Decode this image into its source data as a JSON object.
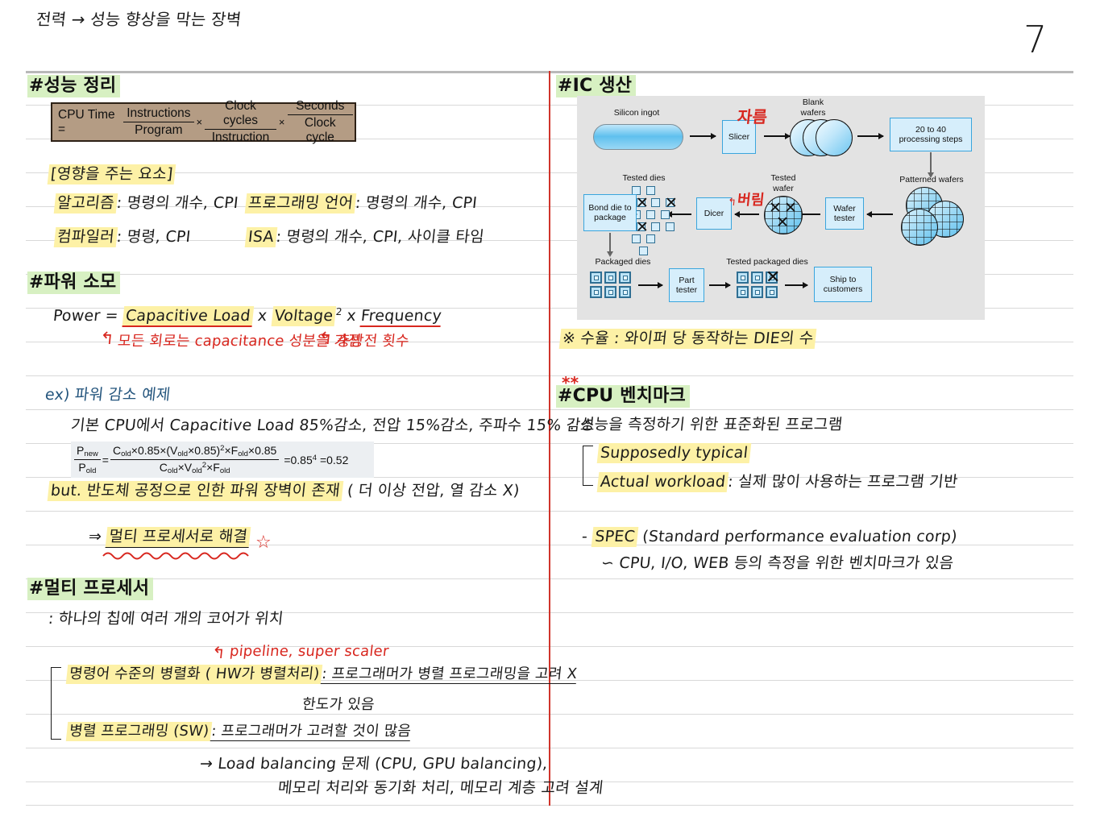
{
  "page": {
    "header_title": "전력 → 성능 향상을 막는 장벽",
    "page_number": "7"
  },
  "left_column": {
    "section1": {
      "heading": "#성능 정리",
      "formula": {
        "lhs": "CPU Time =",
        "f1_num": "Instructions",
        "f1_den": "Program",
        "op1": "×",
        "f2_num": "Clock cycles",
        "f2_den": "Instruction",
        "op2": "×",
        "f3_num": "Seconds",
        "f3_den": "Clock cycle"
      },
      "subtitle": "[영향을 주는 요소]",
      "factors": [
        {
          "term": "알고리즘",
          "desc": ": 명령의 개수, CPI"
        },
        {
          "term": "프로그래밍 언어",
          "desc": ": 명령의 개수, CPI"
        },
        {
          "term": "컴파일러",
          "desc": ": 명령, CPI"
        },
        {
          "term": "ISA",
          "desc": ": 명령의 개수, CPI, 사이클 타임"
        }
      ]
    },
    "section2": {
      "heading": "#파워 소모",
      "formula_lead": "Power =",
      "formula_t1": "Capacitive Load",
      "formula_op1": "x",
      "formula_t2": "Voltage",
      "formula_t2_sup": "2",
      "formula_op2": "x",
      "formula_t3": "Frequency",
      "note1": "모든 회로는 capacitance 성분을 가짐",
      "note2": "충방전 횟수",
      "example_label": "ex) 파워 감소 예제",
      "example_text": "기본 CPU에서  Capacitive Load 85%감소, 전압 15%감소, 주파수 15% 감소",
      "ratio": {
        "lhs_num": "P",
        "lhs_num_sub": "new",
        "lhs_den": "P",
        "lhs_den_sub": "old",
        "eq1": "=",
        "num": "C_old × 0.85 × (V_old × 0.85)² × F_old × 0.85",
        "den": "C_old × V_old² × F_old",
        "result": "= 0.85⁴ = 0.52"
      },
      "but_line_hl": "but. 반도체 공정으로 인한 파워 장벽이 존재",
      "but_line_rest": "( 더 이상 전압, 열 감소 X)",
      "solution_arrow": "⇒",
      "solution": "멀티 프로세서로 해결"
    },
    "section3": {
      "heading": "#멀티 프로세서",
      "line1": ": 하나의 칩에 여러 개의  코어가 위치",
      "red_note": "pipeline, super scaler",
      "item1_hl": "명령어 수준의 병렬화 ( HW가 병렬처리)",
      "item1_desc": ": 프로그래머가  병렬  프로그래밍을  고려 X",
      "item1_desc2": "한도가 있음",
      "item2_hl": "병렬 프로그래밍 (SW)",
      "item2_desc": ": 프로그래머가  고려할  것이  많음",
      "tail1": "→ Load balancing 문제 (CPU, GPU balancing),",
      "tail2": "메모리 처리와 동기화 처리, 메모리 계층 고려 설계"
    }
  },
  "right_column": {
    "section1": {
      "heading": "#IC 생산",
      "diagram": {
        "labels": {
          "silicon_ingot": "Silicon ingot",
          "blank_wafers_1": "Blank",
          "blank_wafers_2": "wafers",
          "patterned_wafers": "Patterned wafers",
          "tested_dies": "Tested dies",
          "tested_wafer_1": "Tested",
          "tested_wafer_2": "wafer",
          "packaged_dies": "Packaged dies",
          "tested_packaged_dies": "Tested packaged dies"
        },
        "boxes": {
          "slicer": "Slicer",
          "processing_steps": "20 to 40\nprocessing steps",
          "wafer_tester": "Wafer\ntester",
          "dicer": "Dicer",
          "bond_die": "Bond die to\npackage",
          "part_tester": "Part\ntester",
          "ship": "Ship to\ncustomers"
        },
        "annotations": {
          "cut": "자름",
          "discard": "버림"
        }
      },
      "yield_note": "※ 수율 : 와이퍼 당 동작하는 DIE의 수"
    },
    "section2": {
      "stars": "**",
      "heading": "#CPU 벤치마크",
      "line1": ": 성능을 측정하기 위한 표준화된 프로그램",
      "item1": "Supposedly typical",
      "item2_hl": "Actual workload",
      "item2_desc": ": 실제 많이 사용하는 프로그램 기반",
      "spec_dash": "-",
      "spec_hl": "SPEC",
      "spec_rest": "(Standard performance evaluation corp)",
      "spec_note": "CPU, I/O, WEB 등의 측정을 위한 벤치마크가 있음"
    }
  },
  "colors": {
    "highlight_green": "#d7f0c2",
    "highlight_yellow": "#fdf1a6",
    "red_ink": "#d8271f",
    "blue_ink": "#24557d",
    "rule_line": "#d9d9d9",
    "divider_red": "#d0352b",
    "formula_box_bg": "#b49c84",
    "diagram_bg": "#e3e3e3",
    "diagram_box": "#d6eefb"
  }
}
